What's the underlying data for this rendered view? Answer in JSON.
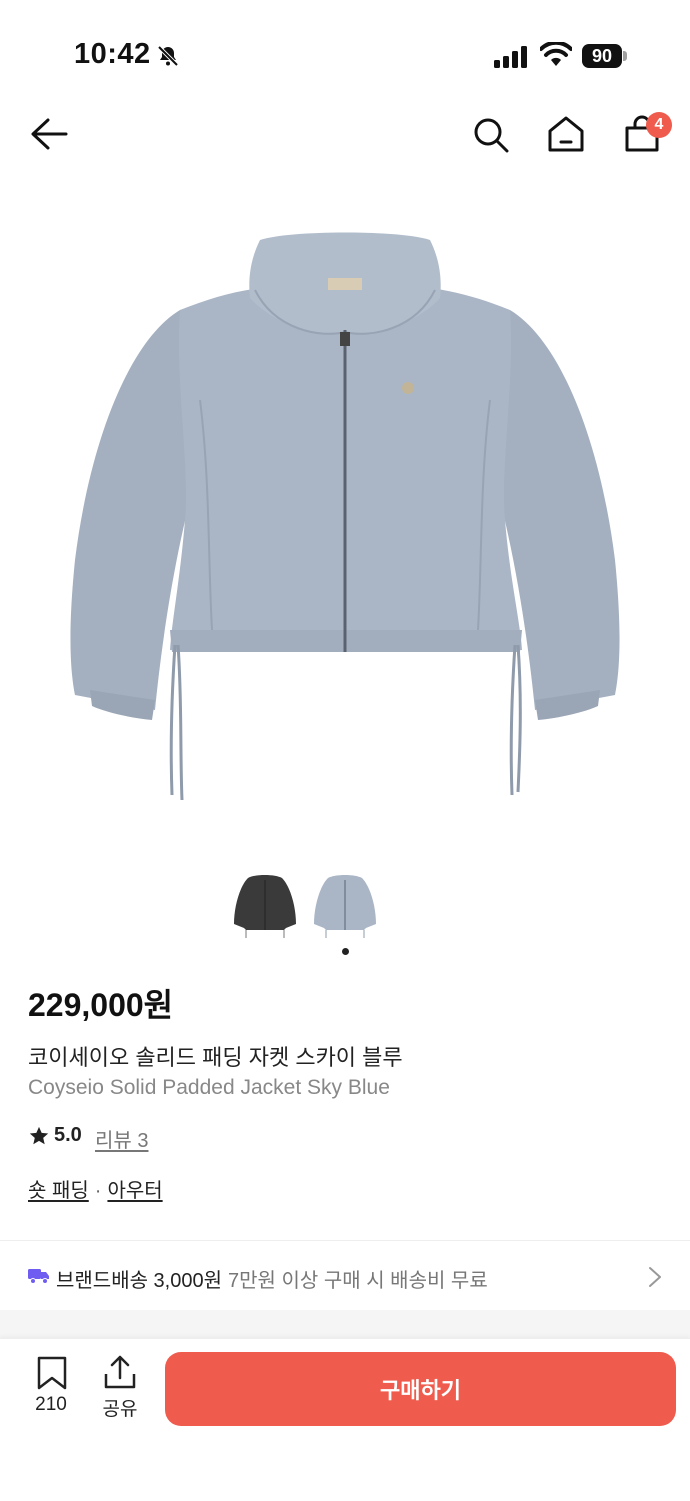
{
  "status_bar": {
    "time": "10:42",
    "battery": "90"
  },
  "header": {
    "cart_count": "4"
  },
  "product": {
    "price": "229,000원",
    "name_ko": "코이세이오 솔리드 패딩 자켓 스카이 블루",
    "name_en": "Coyseio Solid Padded Jacket Sky Blue",
    "rating": "5.0",
    "review_link": "리뷰 3",
    "categories": [
      "숏 패딩",
      "아우터"
    ],
    "category_separator": "·",
    "jacket_color": "#aab6c6"
  },
  "shipping": {
    "label": "브랜드배송 3,000원",
    "note": "7만원 이상 구매 시 배송비 무료"
  },
  "bottom_bar": {
    "bookmark_count": "210",
    "share_label": "공유",
    "buy_label": "구매하기"
  },
  "colors": {
    "accent": "#ef5b4c",
    "shipping_icon": "#6f5cf0"
  }
}
